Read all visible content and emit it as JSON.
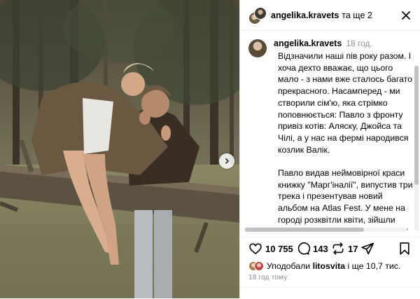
{
  "header": {
    "username": "angelika.kravets",
    "and_more": "та ще 2"
  },
  "caption": {
    "username": "angelika.kravets",
    "time": "18 год.",
    "paragraphs": [
      "Відзначили наші пів року разом. І хоча дехто вважає, що цього мало - з нами вже сталось багато прекрасного. Насамперед - ми створили сім'ю, яка стрімко поповнюється: Павло з фронту привіз котів: Аляску, Джойса та Чілі, а у нас на фермі народився козлик Валік.",
      "Павло видав неймовірної краси книжку \"Марг'іналії\", випустив три трека і презентував новий альбом на Atlas Fest. У мене на городі розквітли квіти, зійшли помідори, огірки, зелень, ягоди, і куди ж без кабачків. Зараз фарбую вікна і двері в нашому домі, поки Павло на Сумському напрямку."
    ]
  },
  "actions": {
    "likes_count": "10 755",
    "comments_count": "143",
    "reposts_count": "17"
  },
  "likes": {
    "prefix": "Уподобали",
    "user": "litosvita",
    "suffix": "і ще 10,7 тис."
  },
  "timestamp": "18 год тому",
  "icons": {
    "close": "close-icon",
    "like": "heart-icon",
    "comment": "comment-icon",
    "repost": "repost-icon",
    "share": "share-icon",
    "save": "bookmark-icon",
    "next": "chevron-right-icon"
  }
}
